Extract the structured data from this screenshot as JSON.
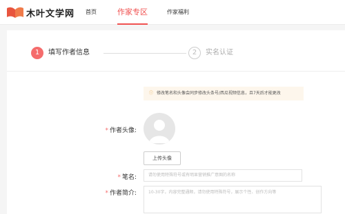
{
  "nav": {
    "logo_text": "木叶文学网",
    "items": [
      "首页",
      "作家专区",
      "作家福利"
    ]
  },
  "steps": [
    {
      "num": "1",
      "label": "填写作者信息"
    },
    {
      "num": "2",
      "label": "实名认证"
    }
  ],
  "notice": {
    "icon": "info-circle-icon",
    "text": "修改笔名和头像会同步修改头条号/西瓜视频信息，且7天后才能更改"
  },
  "form": {
    "avatar_label": "作者头像:",
    "upload_label": "上传头像",
    "penname_label": "笔名:",
    "penname_placeholder": "请勿使用特殊符号或有明显营销推广意图的名称",
    "intro_label": "作者简介:",
    "intro_placeholder": "10-30字，内容完整通顺，请勿使用特殊符号，展示个性、创作方向等"
  },
  "colors": {
    "accent": "#f0504f",
    "step_active": "#f56c6c",
    "notice_bg": "#fdf6ec"
  }
}
